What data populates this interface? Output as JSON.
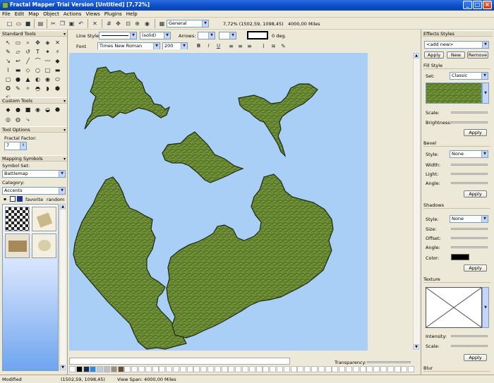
{
  "window": {
    "title": "Fractal Mapper Trial Version [Untitled] [7,72%]"
  },
  "menu": [
    "File",
    "Edit",
    "Map",
    "Object",
    "Actions",
    "Views",
    "Plugins",
    "Help"
  ],
  "toolbar": {
    "layer": "General",
    "zoom_readout": "7,72% (1502,59, 1098,45)",
    "distance": "4000,00 Miles"
  },
  "line_toolbar": {
    "line_style_label": "Line Style",
    "pattern": "(solid)",
    "arrows_label": "Arrows:",
    "angle": "0 deg."
  },
  "font_toolbar": {
    "font_label": "Font",
    "font_name": "Times New Roman",
    "font_size": "200"
  },
  "left": {
    "standard_tools": "Standard Tools",
    "custom_tools": "Custom Tools",
    "tool_options": "Tool Options",
    "fractal_factor_label": "Fractal Factor:",
    "fractal_factor": "7",
    "mapping_symbols": "Mapping Symbols",
    "symbol_set_label": "Symbol Set:",
    "symbol_set": "Battlemap",
    "category_label": "Category:",
    "category": "Accents",
    "favorite": "favorite",
    "random": "random"
  },
  "right": {
    "effects_styles": "Effects Styles",
    "add_new": "<add new>",
    "apply": "Apply",
    "new": "New",
    "remove": "Remove",
    "fill_style": "Fill Style",
    "set_label": "Set:",
    "set_value": "Classic",
    "scale_label": "Scale:",
    "brightness_label": "Brightness:",
    "bevel": "Bevel",
    "style_label": "Style:",
    "none": "None",
    "width_label": "Width:",
    "light_label": "Light:",
    "angle_label": "Angle:",
    "shadows": "Shadows",
    "size_label": "Size:",
    "offset_label": "Offset:",
    "color_label": "Color:",
    "texture": "Texture",
    "intensity_label": "Intensity:",
    "blur": "Blur"
  },
  "bottom": {
    "transparency_label": "Transparency:"
  },
  "status": {
    "state": "Modified",
    "coords": "(1502,59, 1098,45)",
    "view_span": "View Span: 4000,00 Miles"
  },
  "colors": {
    "title_blue": "#0a4cc6",
    "sea": "#a9cff7",
    "land": "#6b8a34",
    "palette": [
      "#000000",
      "#1a2a4a",
      "#2b8be0",
      "#b9cfe0",
      "#c0c0c0",
      "#9a8f86",
      "#6b4a34"
    ]
  },
  "icons": [
    "new-icon",
    "open-icon",
    "save-icon",
    "print-icon",
    "cut-icon",
    "copy-icon",
    "paste-icon",
    "undo-icon",
    "redo-icon",
    "delete-icon",
    "grid-icon",
    "move-icon",
    "zoom-icon",
    "zoom-in-icon",
    "globe-icon",
    "layer-icon"
  ]
}
